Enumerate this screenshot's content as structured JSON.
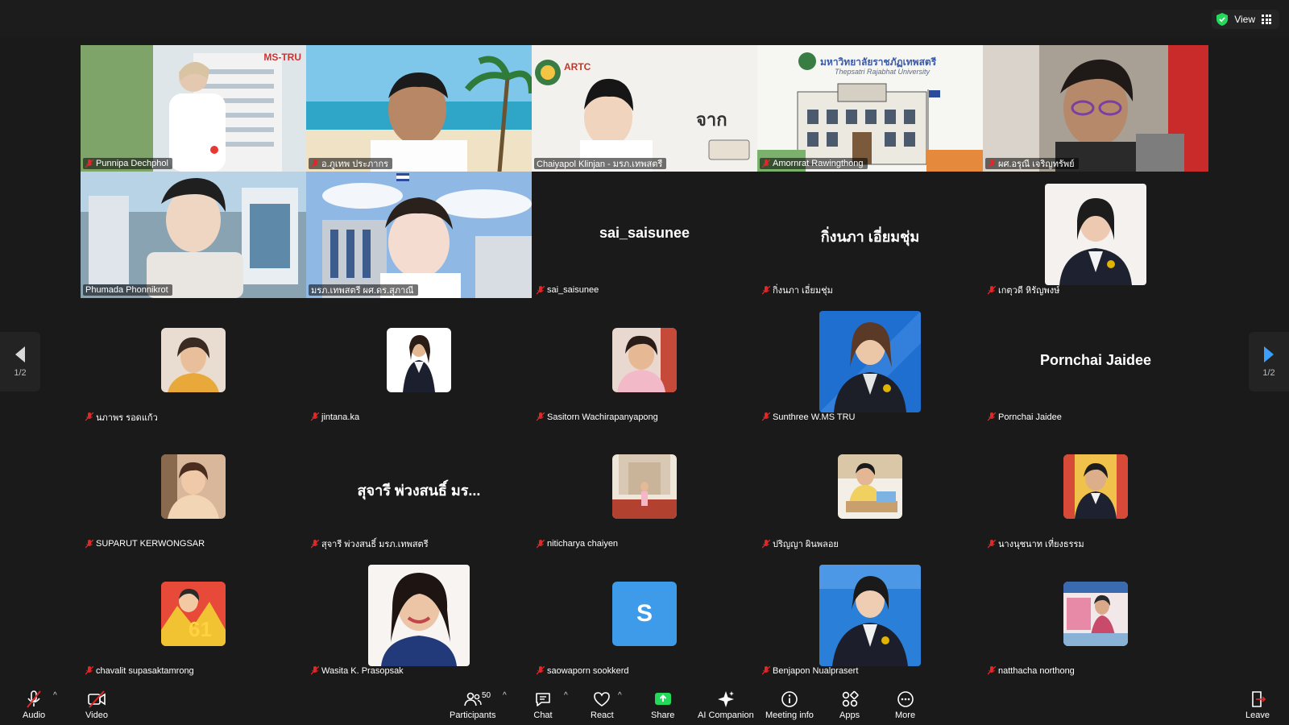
{
  "top_bar": {
    "view_label": "View"
  },
  "pager": {
    "left": "1/2",
    "right": "1/2"
  },
  "tiles": [
    {
      "name": "Punnipa Dechphol",
      "kind": "video"
    },
    {
      "name": "อ.ภูเทพ ประภากร",
      "kind": "video"
    },
    {
      "name": "Chaiyapol Klinjan - มรภ.เทพสตรี",
      "kind": "video"
    },
    {
      "name": "Amornrat Rawingthong",
      "kind": "video"
    },
    {
      "name": "ผศ.อรุณี เจริญทรัพย์",
      "kind": "video"
    },
    {
      "name": "Phumada Phonnikrot",
      "kind": "video"
    },
    {
      "name": "มรภ.เทพสตรี ผศ.ดร.สุภาณี",
      "kind": "video"
    },
    {
      "name": "sai_saisunee",
      "kind": "bigname",
      "big": "sai_saisunee"
    },
    {
      "name": "กิ่งนภา เอี่ยมชุ่ม",
      "kind": "bigname",
      "big": "กิ่งนภา เอี่ยมชุ่ม"
    },
    {
      "name": "เกตุวดี หิรัญพงษ์",
      "kind": "avatar-lg"
    },
    {
      "name": "นภาพร รอดแก้ว",
      "kind": "avatar-sm"
    },
    {
      "name": "jintana.ka",
      "kind": "avatar-sm"
    },
    {
      "name": "Sasitorn Wachirapanyapong",
      "kind": "avatar-sm"
    },
    {
      "name": "Sunthree W.MS TRU",
      "kind": "avatar-lg"
    },
    {
      "name": "Pornchai Jaidee",
      "kind": "bigname",
      "big": "Pornchai Jaidee"
    },
    {
      "name": "SUPARUT KERWONGSAR",
      "kind": "avatar-sm"
    },
    {
      "name": "สุจารี พ่วงสนธิ์ มรภ.เทพสตรี",
      "kind": "bigname",
      "big": "สุจารี พ่วงสนธิ์ มร..."
    },
    {
      "name": "niticharya chaiyen",
      "kind": "avatar-sm"
    },
    {
      "name": "ปริญญา ผินพลอย",
      "kind": "avatar-sm"
    },
    {
      "name": "นางนุชนาท เที่ยงธรรม",
      "kind": "avatar-sm"
    },
    {
      "name": "chavalit supasaktamrong",
      "kind": "avatar-sm"
    },
    {
      "name": "Wasita K. Prasopsak",
      "kind": "avatar-lg"
    },
    {
      "name": "saowaporn sookkerd",
      "kind": "avatar-letter",
      "letter": "S"
    },
    {
      "name": "Benjapon Nualprasert",
      "kind": "avatar-lg"
    },
    {
      "name": "natthacha northong",
      "kind": "avatar-sm"
    }
  ],
  "tile_overlays": {
    "ms_tru_logo": "MS-TRU",
    "university_banner": "มหาวิทยาลัยราชภัฏเทพสตรี",
    "university_banner_en": "Thepsatri Rajabhat University",
    "artc_logo": "ARTC",
    "avatar_number": "61"
  },
  "toolbar": {
    "audio": "Audio",
    "video": "Video",
    "participants": "Participants",
    "participants_count": "50",
    "chat": "Chat",
    "react": "React",
    "share": "Share",
    "ai_companion": "AI Companion",
    "meeting_info": "Meeting info",
    "apps": "Apps",
    "more": "More",
    "leave": "Leave"
  },
  "colors": {
    "background": "#1a1a1a",
    "active_speaker": "#2ecc71",
    "share_green": "#23d959",
    "mute_red": "#e02828",
    "letter_avatar": "#3d9be9",
    "security_shield": "#23d959"
  }
}
